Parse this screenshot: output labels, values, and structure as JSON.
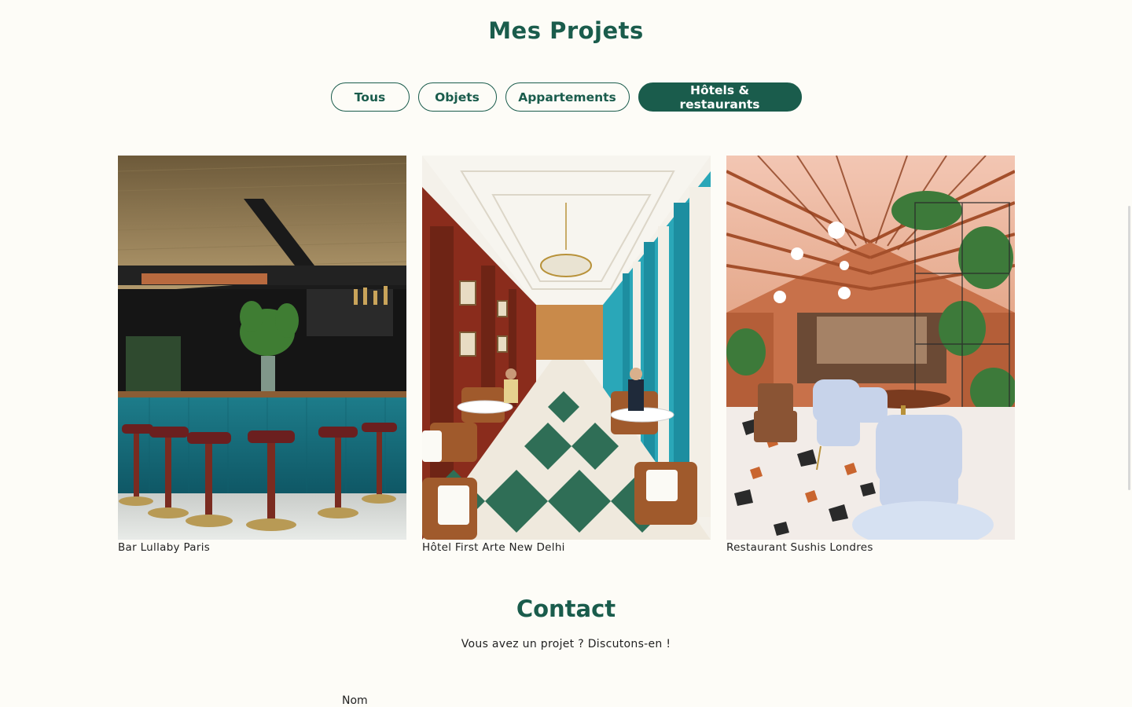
{
  "projects": {
    "title": "Mes Projets",
    "filters": [
      {
        "label": "Tous",
        "active": false
      },
      {
        "label": "Objets",
        "active": false
      },
      {
        "label": "Appartements",
        "active": false
      },
      {
        "label": "Hôtels & restaurants",
        "active": true
      }
    ],
    "items": [
      {
        "caption": "Bar Lullaby Paris"
      },
      {
        "caption": "Hôtel First Arte New Delhi"
      },
      {
        "caption": "Restaurant Sushis Londres"
      }
    ]
  },
  "contact": {
    "title": "Contact",
    "subtitle": "Vous avez un projet ? Discutons-en !",
    "fields": {
      "name_label": "Nom"
    }
  },
  "colors": {
    "brand": "#1a5c4c",
    "background": "#fdfcf7"
  }
}
